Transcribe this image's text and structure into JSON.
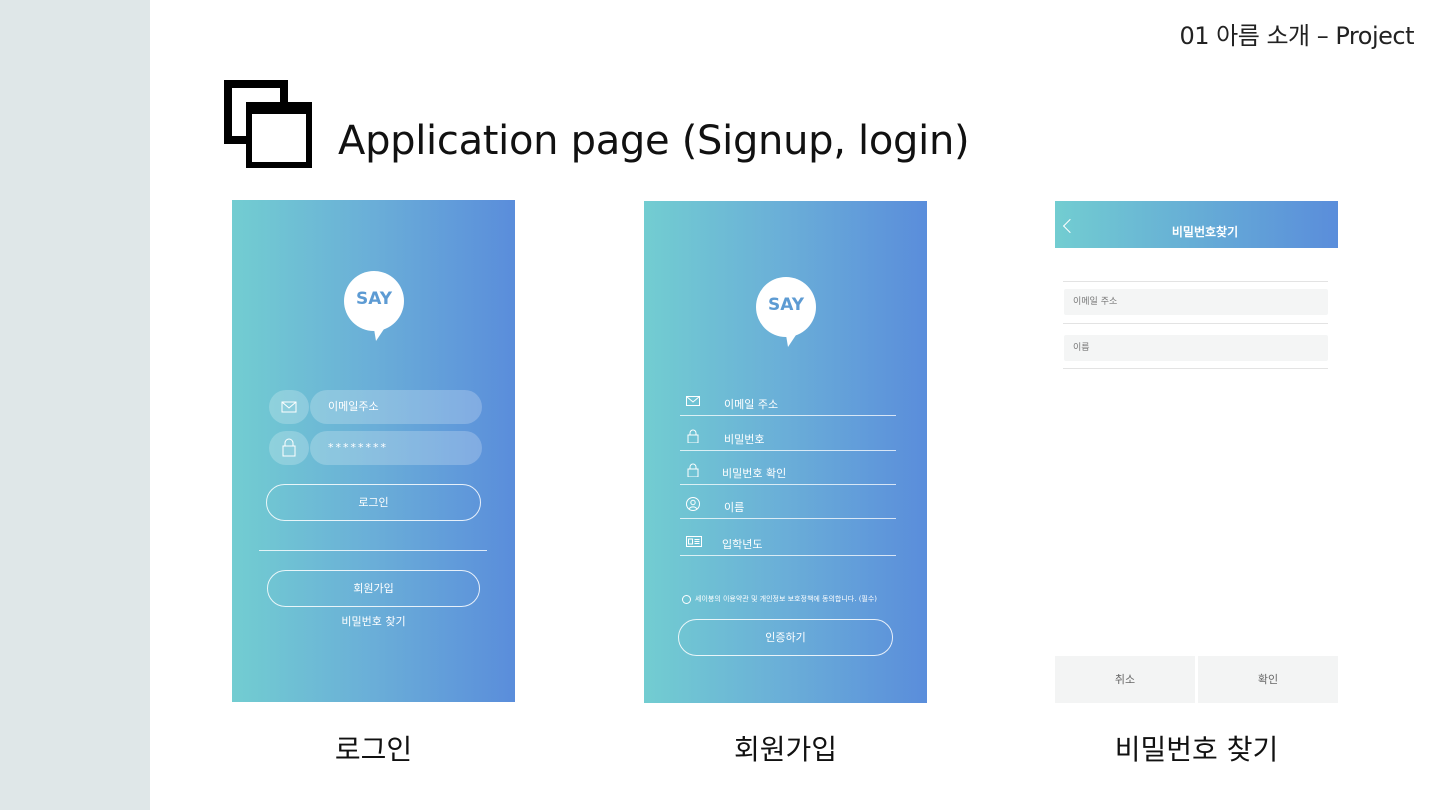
{
  "header": {
    "section": "01 아름 소개 – Project"
  },
  "title": {
    "text": "Application page (Signup, login)"
  },
  "login": {
    "logo_text": "SAY",
    "email_placeholder": "이메일주소",
    "password_value": "********",
    "login_button": "로그인",
    "signup_button": "회원가입",
    "find_password_link": "비밀번호 찾기"
  },
  "signup": {
    "logo_text": "SAY",
    "fields": [
      {
        "label": "이메일 주소",
        "icon": "envelope-icon"
      },
      {
        "label": "비밀번호",
        "icon": "lock-icon"
      },
      {
        "label": "비밀번호 확인",
        "icon": "lock-icon"
      },
      {
        "label": "이름",
        "icon": "user-icon"
      },
      {
        "label": "입학년도",
        "icon": "id-card-icon"
      }
    ],
    "terms": "세이봉의 이용약관 및 개인정보 보호정책에 동의합니다. (필수)",
    "verify_button": "인증하기"
  },
  "find_password": {
    "title": "비밀번호찾기",
    "email_placeholder": "이메일 주소",
    "name_placeholder": "이름",
    "cancel_button": "취소",
    "confirm_button": "확인"
  },
  "captions": {
    "login": "로그인",
    "signup": "회원가입",
    "find_password": "비밀번호 찾기"
  },
  "colors": {
    "gradient_start": "#72cdd1",
    "gradient_end": "#5a8ddb",
    "side_band": "#dfe7e8"
  }
}
